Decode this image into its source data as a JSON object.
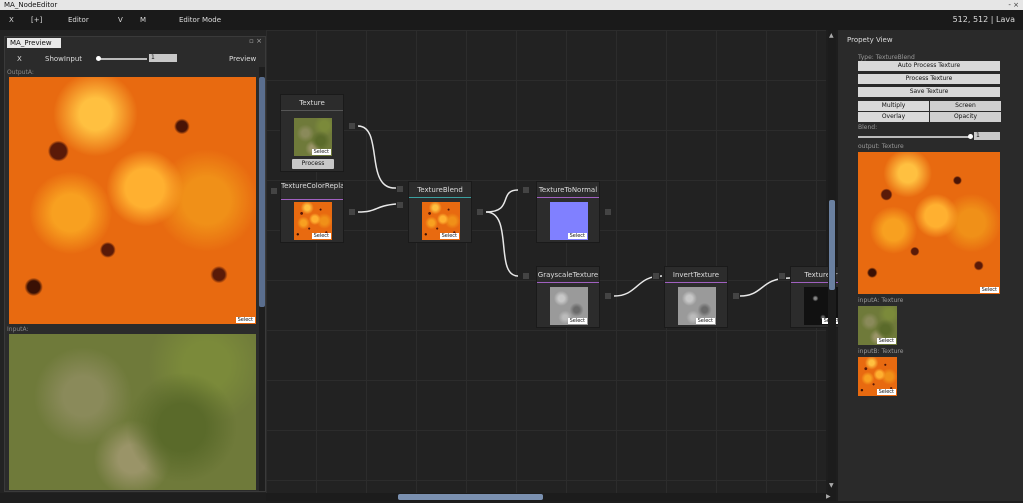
{
  "window": {
    "title": "MA_NodeEditor",
    "minimize_glyph": "-",
    "close_glyph": "×"
  },
  "menubar": {
    "close_label": "X",
    "add_label": "[+]",
    "editor_label": "Editor",
    "v_label": "V",
    "m_label": "M",
    "editor_mode_label": "Editor Mode",
    "info": "512, 512 | Lava"
  },
  "preview": {
    "title": "MA_Preview",
    "close_label": "X",
    "show_input_label": "ShowInput",
    "slider_value": "1",
    "preview_label": "Preview",
    "output_label": "OutputA:",
    "input_label": "InputA:",
    "select_label": "Select"
  },
  "nodes": {
    "texture": {
      "title": "Texture",
      "select": "Select",
      "process": "Process"
    },
    "color_replace": {
      "title": "TextureColorReplace",
      "select": "Select"
    },
    "blend": {
      "title": "TextureBlend",
      "select": "Select"
    },
    "to_normal": {
      "title": "TextureToNormal",
      "select": "Select"
    },
    "grayscale": {
      "title": "GrayscaleTexture",
      "select": "Select"
    },
    "invert": {
      "title": "InvertTexture",
      "select": "Select"
    },
    "brightness": {
      "title": "TextureBri",
      "select": "Select"
    }
  },
  "property_view": {
    "title": "Propety View",
    "type_label": "Type: TextureBlend",
    "auto_process": "Auto Process Texture",
    "process": "Process Texture",
    "save": "Save Texture",
    "multiply": "Multiply",
    "screen": "Screen",
    "overlay": "Overlay",
    "opacity": "Opacity",
    "blend_label": "Blend:",
    "blend_value": "1",
    "output_label": "output: Texture",
    "inputA_label": "inputA: Texture",
    "inputB_label": "inputB: Texture",
    "select": "Select"
  }
}
